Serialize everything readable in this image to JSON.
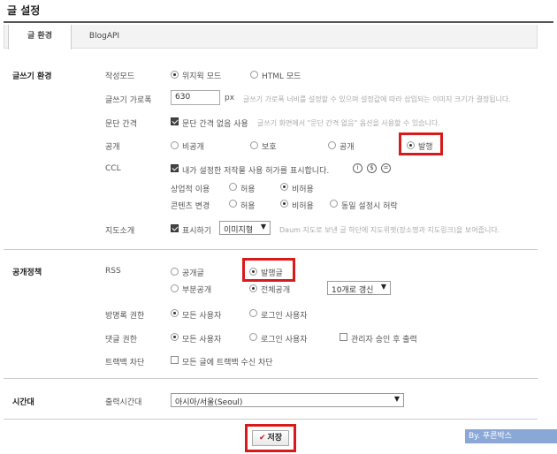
{
  "page_title": "글 설정",
  "tabs": [
    {
      "label": "글 환경",
      "active": true
    },
    {
      "label": "BlogAPI",
      "active": false
    }
  ],
  "writing": {
    "section_label": "글쓰기 환경",
    "mode": {
      "label": "작성모드",
      "options": [
        "위지윅 모드",
        "HTML 모드"
      ],
      "selected": "위지윅 모드"
    },
    "width": {
      "label": "글쓰기 가로폭",
      "value": "630",
      "unit": "px",
      "hint": "글쓰기 가로폭 너비를 설정할 수 있으며 설정값에 따라 삽입되는 이미지 크기가 결정됩니다."
    },
    "paragraph": {
      "label": "문단 간격",
      "checkbox_label": "문단 간격 없음 사용",
      "checked": true,
      "hint": "글쓰기 화면에서 \"문단 간격 없음\" 옵션을 사용할 수 있습니다."
    },
    "visibility": {
      "label": "공개",
      "options": [
        "비공개",
        "보호",
        "공개",
        "발행"
      ],
      "selected": "발행"
    },
    "ccl": {
      "label": "CCL",
      "checkbox_label": "내가 설정한 저작물 사용 허가를 표시합니다.",
      "checked": true,
      "icons": [
        "i",
        "$",
        "="
      ],
      "commercial": {
        "label": "상업적 이용",
        "options": [
          "허용",
          "비허용"
        ],
        "selected": "비허용"
      },
      "modify": {
        "label": "콘텐츠 변경",
        "options": [
          "허용",
          "비허용",
          "동일 설정시 허락"
        ],
        "selected": "비허용"
      }
    },
    "map": {
      "label": "지도소개",
      "checkbox_label": "표시하기",
      "checked": true,
      "select_value": "이미지형",
      "hint": "Daum 지도로 보낸 글 하단에 지도위젯(장소명과 지도링크)을 보여줍니다."
    }
  },
  "policy": {
    "section_label": "공개정책",
    "rss": {
      "label": "RSS",
      "row1": {
        "options": [
          "공개글",
          "발행글"
        ],
        "selected": "발행글"
      },
      "row2": {
        "options": [
          "부분공개",
          "전체공개"
        ],
        "selected": "전체공개"
      },
      "refresh_value": "10개로 갱신"
    },
    "guestbook": {
      "label": "방명록 권한",
      "options": [
        "모든 사용자",
        "로그인 사용자"
      ],
      "selected": "모든 사용자"
    },
    "comment": {
      "label": "댓글 권한",
      "options": [
        "모든 사용자",
        "로그인 사용자"
      ],
      "selected": "모든 사용자",
      "approval_label": "관리자 승인 후 출력",
      "approval_checked": false
    },
    "trackback": {
      "label": "트랙백 차단",
      "checkbox_label": "모든 글에 트랙백 수신 차단",
      "checked": false
    }
  },
  "timezone": {
    "section_label": "시간대",
    "label": "출력시간대",
    "value": "아시아/서울(Seoul)"
  },
  "save_label": "저장",
  "watermark": "By. 푸른박스",
  "colors": {
    "highlight": "#d91a1a",
    "watermark_bg": "#8aa8d6"
  }
}
